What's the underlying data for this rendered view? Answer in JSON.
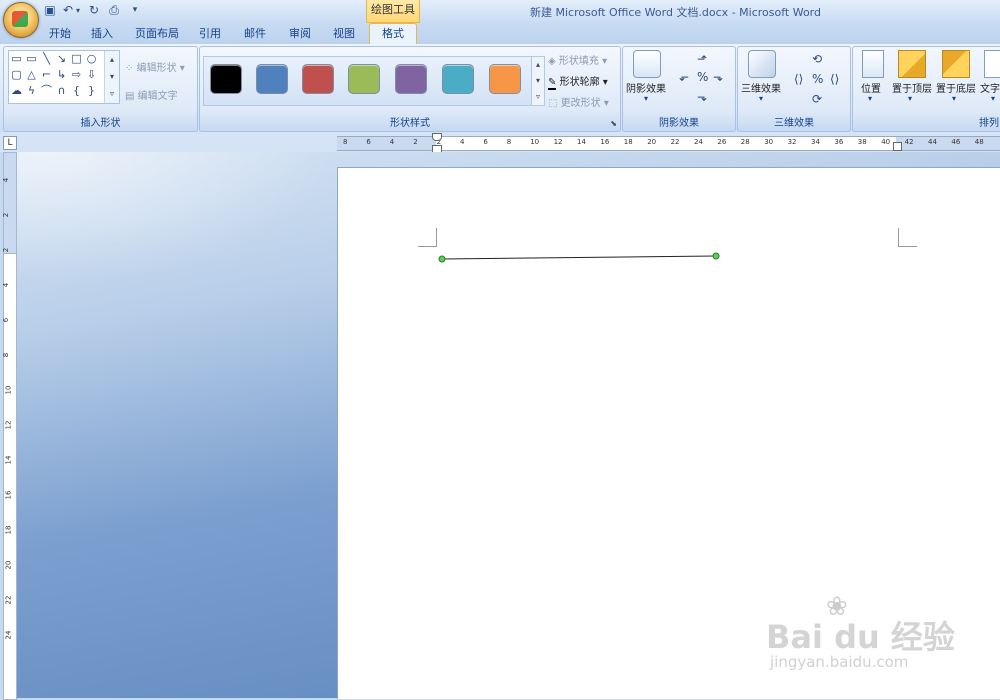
{
  "window": {
    "title": "新建 Microsoft Office Word 文档.docx - Microsoft Word"
  },
  "contextual_tab_header": "绘图工具",
  "quick_access": {
    "save": "save-icon",
    "undo": "undo-icon",
    "redo": "redo-icon",
    "print_preview": "print-preview-icon",
    "customize": "▾"
  },
  "tabs": [
    {
      "label": "开始"
    },
    {
      "label": "插入"
    },
    {
      "label": "页面布局"
    },
    {
      "label": "引用"
    },
    {
      "label": "邮件"
    },
    {
      "label": "审阅"
    },
    {
      "label": "视图"
    },
    {
      "label": "格式",
      "active": true
    }
  ],
  "groups": {
    "insert_shapes": {
      "label": "插入形状",
      "edit_shape": "编辑形状",
      "edit_text": "编辑文字"
    },
    "shape_styles": {
      "label": "形状样式",
      "swatches": [
        "#000000",
        "#4f81bd",
        "#c0504d",
        "#9bbb59",
        "#8064a2",
        "#4bacc6",
        "#f79646"
      ],
      "fill": "形状填充",
      "outline": "形状轮廓",
      "change": "更改形状"
    },
    "shadow": {
      "label": "阴影效果",
      "button": "阴影效果"
    },
    "three_d": {
      "label": "三维效果",
      "button": "三维效果"
    },
    "arrange": {
      "label": "排列",
      "position": "位置",
      "bring_front": "置于顶层",
      "send_back": "置于底层",
      "text_wrap": "文字"
    }
  },
  "ruler": {
    "tab_selector": "L",
    "h_ticks": [
      "8",
      "6",
      "4",
      "2",
      "2",
      "4",
      "6",
      "8",
      "10",
      "12",
      "14",
      "16",
      "18",
      "20",
      "22",
      "24",
      "26",
      "28",
      "30",
      "32",
      "34",
      "36",
      "38",
      "40",
      "42",
      "44",
      "46",
      "48"
    ],
    "v_ticks": [
      "4",
      "2",
      "2",
      "4",
      "6",
      "8",
      "10",
      "12",
      "14",
      "16",
      "18",
      "20",
      "22",
      "24"
    ]
  },
  "watermark": {
    "brand": "Bai du 经验",
    "url": "jingyan.baidu.com"
  },
  "colors": {
    "accent": "#15428b",
    "ribbon": "#dbe7f6",
    "line_handle": "#3c9a3c"
  }
}
